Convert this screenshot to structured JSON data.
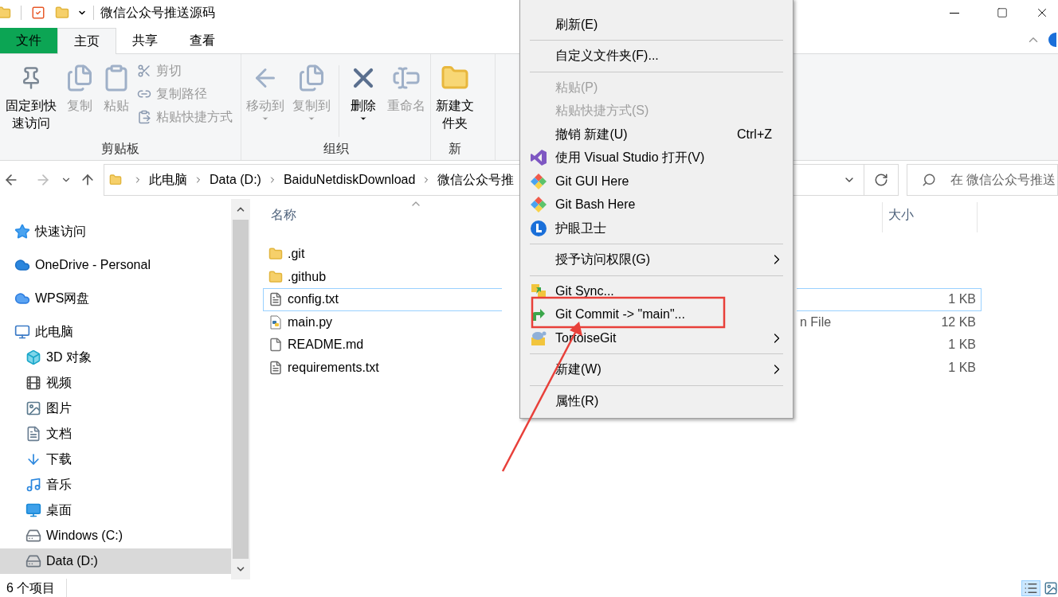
{
  "window": {
    "title": "微信公众号推送源码"
  },
  "ribbon_tabs": [
    {
      "label": "文件",
      "kind": "file",
      "selected": false
    },
    {
      "label": "主页",
      "kind": "tab",
      "selected": true
    },
    {
      "label": "共享",
      "kind": "tab",
      "selected": false
    },
    {
      "label": "查看",
      "kind": "tab",
      "selected": false
    }
  ],
  "ribbon_groups": [
    {
      "label": "剪贴板",
      "items": [
        {
          "label": "固定到快速访问",
          "kind": "large",
          "disabled": false
        },
        {
          "label": "复制",
          "kind": "large",
          "disabled": true
        },
        {
          "label": "粘贴",
          "kind": "large",
          "disabled": true
        },
        {
          "kind": "stack",
          "items": [
            {
              "label": "剪切",
              "disabled": true
            },
            {
              "label": "复制路径",
              "disabled": true
            },
            {
              "label": "粘贴快捷方式",
              "disabled": true
            }
          ]
        }
      ]
    },
    {
      "label": "组织",
      "items": [
        {
          "label": "移动到",
          "kind": "dropdown",
          "disabled": true
        },
        {
          "label": "复制到",
          "kind": "dropdown",
          "disabled": true
        },
        {
          "kind": "divider"
        },
        {
          "label": "删除",
          "kind": "dropdown",
          "disabled": false
        },
        {
          "label": "重命名",
          "kind": "large",
          "disabled": true
        }
      ]
    },
    {
      "label": "新",
      "items": [
        {
          "label": "新建文件夹",
          "kind": "large",
          "disabled": false
        }
      ]
    }
  ],
  "address": {
    "crumbs": [
      "此电脑",
      "Data (D:)",
      "BaiduNetdiskDownload",
      "微信公众号推"
    ],
    "search_placeholder": "在 微信公众号推送"
  },
  "nav": [
    {
      "label": "快速访问",
      "selected": false
    },
    {
      "label": "OneDrive - Personal",
      "selected": false
    },
    {
      "label": "WPS网盘",
      "selected": false
    },
    {
      "label": "此电脑",
      "selected": false,
      "children": [
        {
          "label": "3D 对象",
          "selected": false
        },
        {
          "label": "视频",
          "selected": false
        },
        {
          "label": "图片",
          "selected": false
        },
        {
          "label": "文档",
          "selected": false
        },
        {
          "label": "下载",
          "selected": false
        },
        {
          "label": "音乐",
          "selected": false
        },
        {
          "label": "桌面",
          "selected": false
        },
        {
          "label": "Windows (C:)",
          "selected": false
        },
        {
          "label": "Data (D:)",
          "selected": true
        }
      ]
    }
  ],
  "files": {
    "columns": [
      "名称",
      "大小"
    ],
    "rows": [
      {
        "name": ".git",
        "kind": "folder",
        "focused": false
      },
      {
        "name": ".github",
        "kind": "folder",
        "focused": false
      },
      {
        "name": "config.txt",
        "kind": "text",
        "size": "1 KB",
        "focused": true
      },
      {
        "name": "main.py",
        "kind": "python",
        "type": "n File",
        "size": "12 KB",
        "focused": false
      },
      {
        "name": "README.md",
        "kind": "blank",
        "size": "1 KB",
        "focused": false
      },
      {
        "name": "requirements.txt",
        "kind": "text",
        "size": "1 KB",
        "focused": false
      }
    ]
  },
  "status_bar": {
    "count": "6 个项目"
  },
  "context_menu": [
    {
      "kind": "item",
      "label": "刷新(E)",
      "disabled": false
    },
    {
      "kind": "separator"
    },
    {
      "kind": "item",
      "label": "自定义文件夹(F)...",
      "disabled": false
    },
    {
      "kind": "separator"
    },
    {
      "kind": "item",
      "label": "粘贴(P)",
      "disabled": true
    },
    {
      "kind": "item",
      "label": "粘贴快捷方式(S)",
      "disabled": true
    },
    {
      "kind": "item",
      "label": "撤销 新建(U)",
      "shortcut": "Ctrl+Z",
      "disabled": false
    },
    {
      "kind": "item",
      "label": "使用 Visual Studio 打开(V)",
      "disabled": false
    },
    {
      "kind": "item",
      "label": "Git GUI Here",
      "disabled": false
    },
    {
      "kind": "item",
      "label": "Git Bash Here",
      "disabled": false
    },
    {
      "kind": "item",
      "label": "护眼卫士",
      "disabled": false
    },
    {
      "kind": "separator"
    },
    {
      "kind": "item",
      "label": "授予访问权限(G)",
      "submenu": true,
      "disabled": false
    },
    {
      "kind": "separator"
    },
    {
      "kind": "item",
      "label": "Git Sync...",
      "disabled": false
    },
    {
      "kind": "item",
      "label": "Git Commit -> \"main\"...",
      "disabled": false
    },
    {
      "kind": "item",
      "label": "TortoiseGit",
      "submenu": true,
      "disabled": false
    },
    {
      "kind": "separator"
    },
    {
      "kind": "item",
      "label": "新建(W)",
      "submenu": true,
      "disabled": false
    },
    {
      "kind": "separator"
    },
    {
      "kind": "item",
      "label": "属性(R)",
      "disabled": false
    }
  ]
}
